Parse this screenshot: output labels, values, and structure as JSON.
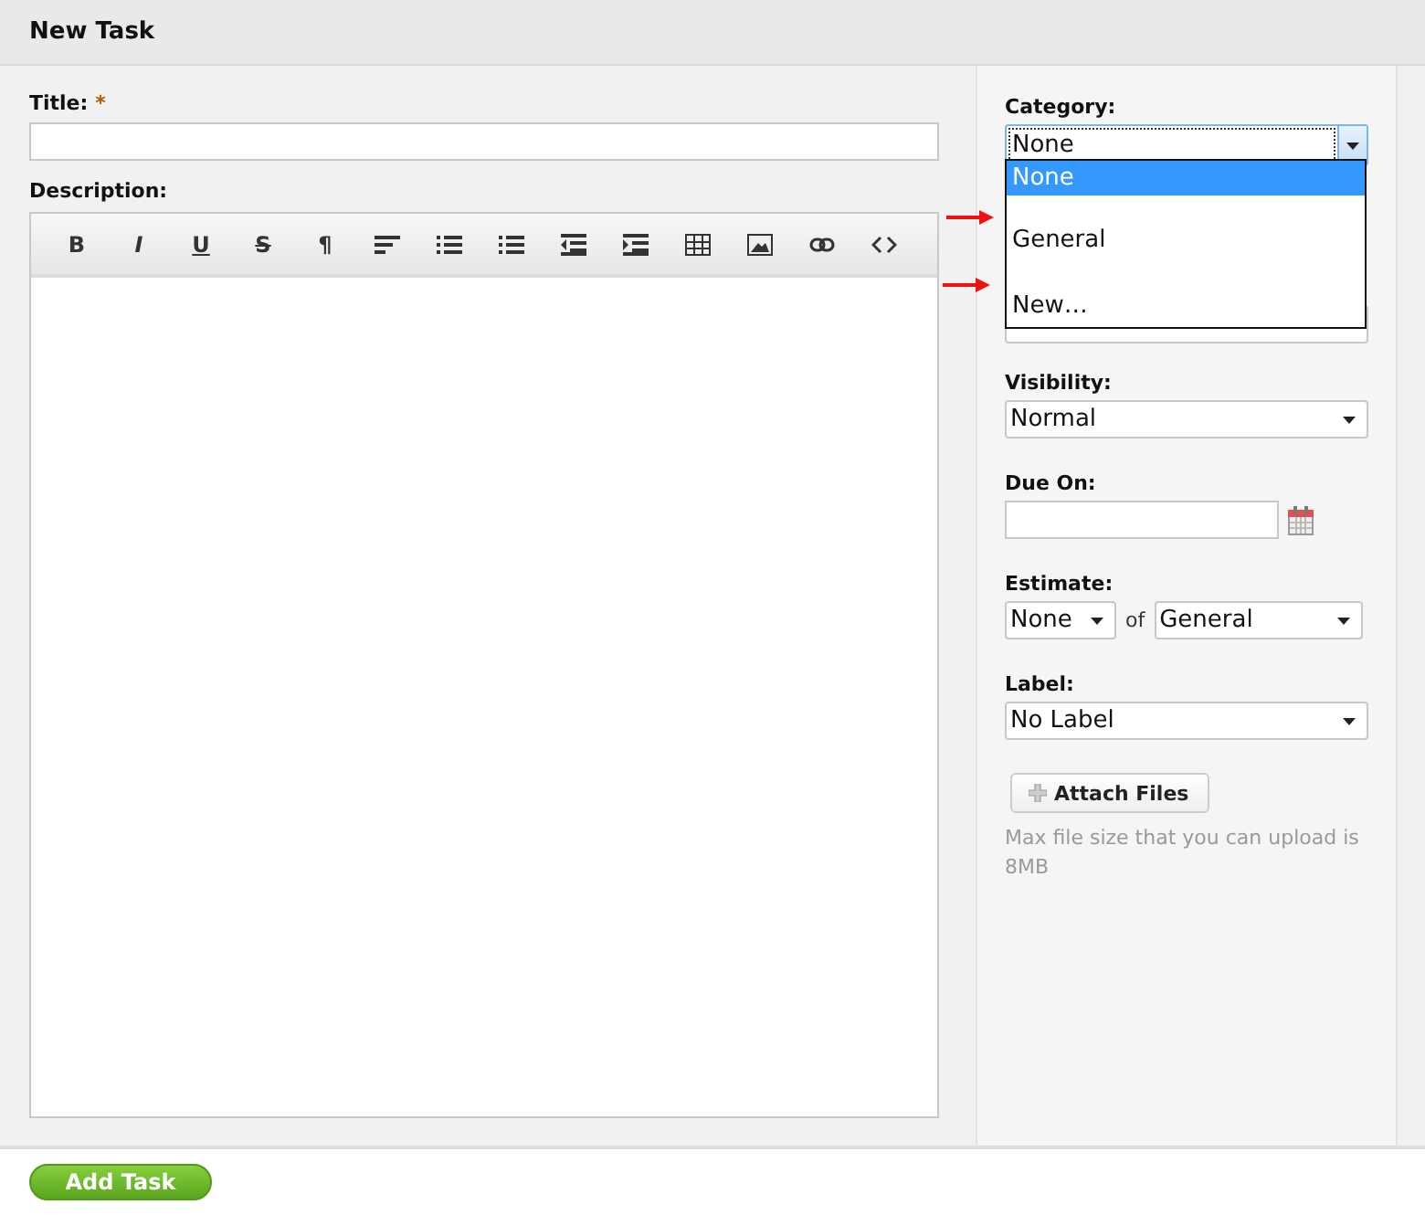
{
  "header": {
    "title": "New Task"
  },
  "title_field": {
    "label": "Title:",
    "required_mark": "*"
  },
  "description": {
    "label": "Description:",
    "toolbar": [
      {
        "kind": "bold",
        "label": "B"
      },
      {
        "kind": "italic",
        "label": "I"
      },
      {
        "kind": "underline",
        "label": "U"
      },
      {
        "kind": "strike",
        "label": "S"
      },
      {
        "kind": "paragraph",
        "label": "¶"
      },
      {
        "kind": "align"
      },
      {
        "kind": "bullets"
      },
      {
        "kind": "numbers"
      },
      {
        "kind": "outdent"
      },
      {
        "kind": "indent"
      },
      {
        "kind": "table"
      },
      {
        "kind": "image"
      },
      {
        "kind": "link"
      },
      {
        "kind": "code"
      }
    ]
  },
  "category": {
    "label": "Category:",
    "value": "None",
    "expanded": true,
    "options": [
      {
        "label": "None",
        "selected": true
      },
      {
        "label": "General",
        "selected": false
      },
      {
        "label": "New…",
        "selected": false
      }
    ]
  },
  "visibility": {
    "label": "Visibility:",
    "value": "Normal"
  },
  "due_on": {
    "label": "Due On:"
  },
  "estimate": {
    "label": "Estimate:",
    "value": "None",
    "separator": "of",
    "unit": "General"
  },
  "label_field": {
    "label": "Label:",
    "value": "No Label"
  },
  "attach": {
    "button": "Attach Files",
    "hint": "Max file size that you can upload is 8MB"
  },
  "footer": {
    "button": "Add Task"
  }
}
